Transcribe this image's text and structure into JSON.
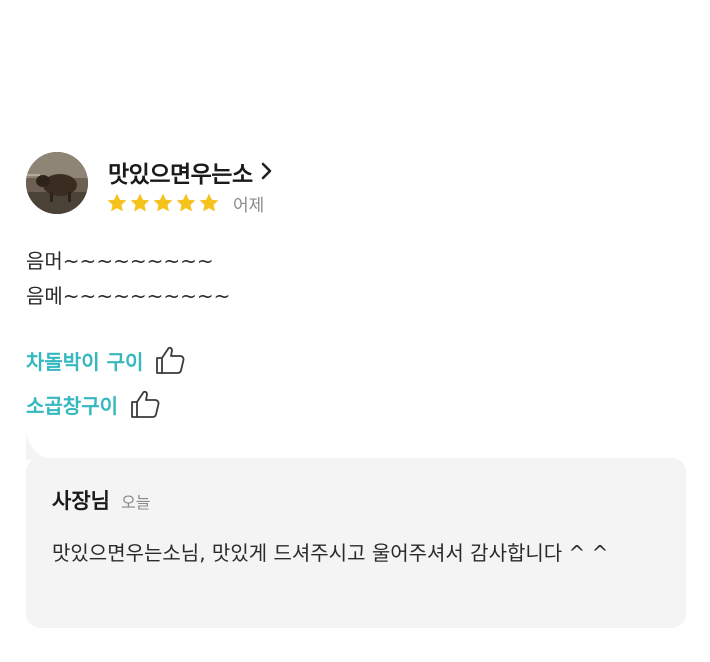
{
  "review": {
    "reviewer_name": "맛있으면우는소",
    "rating": 5,
    "rating_max": 5,
    "date": "어제",
    "body_lines": [
      "음머~~~~~~~~~",
      "음메~~~~~~~~~~"
    ],
    "menu_tags": [
      "차돌박이 구이",
      "소곱창구이"
    ],
    "colors": {
      "star": "#f6c21c",
      "menu_tag": "#35b8c0",
      "reply_bg": "#f4f4f5"
    },
    "icons": {
      "profile": "avatar-photo",
      "more": "chevron-right-icon",
      "star": "star-icon",
      "recommend": "thumbs-up-icon"
    }
  },
  "owner_reply": {
    "author": "사장님",
    "date": "오늘",
    "text": "맛있으면우는소님,  맛있게 드셔주시고 울어주셔서 감사합니다 ^ ^"
  }
}
